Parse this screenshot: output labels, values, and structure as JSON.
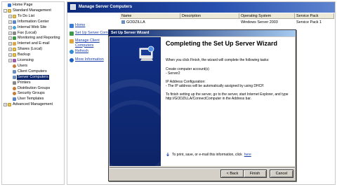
{
  "tree": {
    "items": [
      {
        "label": "Home Page",
        "icon": "home-icon",
        "indent": 0,
        "exp": ""
      },
      {
        "label": "Standard Management",
        "icon": "folder-icon",
        "indent": 0,
        "exp": "-"
      },
      {
        "label": "To Do List",
        "icon": "folder-icon",
        "indent": 1,
        "exp": "+"
      },
      {
        "label": "Information Center",
        "icon": "info-icon",
        "indent": 1,
        "exp": "+"
      },
      {
        "label": "Internal Web Site",
        "icon": "globe-icon",
        "indent": 1,
        "exp": "+"
      },
      {
        "label": "Fax (Local)",
        "icon": "fax-icon",
        "indent": 1,
        "exp": "+"
      },
      {
        "label": "Monitoring and Reporting",
        "icon": "monitor-icon",
        "indent": 1,
        "exp": "+"
      },
      {
        "label": "Internet and E-mail",
        "icon": "mail-icon",
        "indent": 1,
        "exp": "+"
      },
      {
        "label": "Shares (Local)",
        "icon": "folder-icon",
        "indent": 1,
        "exp": "+"
      },
      {
        "label": "Backup",
        "icon": "folder-icon",
        "indent": 1,
        "exp": "+"
      },
      {
        "label": "Licensing",
        "icon": "license-icon",
        "indent": 1,
        "exp": "+"
      },
      {
        "label": "Users",
        "icon": "user-icon",
        "indent": 1,
        "exp": ""
      },
      {
        "label": "Client Computers",
        "icon": "computer-icon",
        "indent": 1,
        "exp": ""
      },
      {
        "label": "Server Computers",
        "icon": "computer-icon",
        "indent": 1,
        "exp": "",
        "selected": true
      },
      {
        "label": "Printers",
        "icon": "printer-icon",
        "indent": 1,
        "exp": ""
      },
      {
        "label": "Distribution Groups",
        "icon": "group-icon",
        "indent": 1,
        "exp": ""
      },
      {
        "label": "Security Groups",
        "icon": "group-icon",
        "indent": 1,
        "exp": ""
      },
      {
        "label": "User Templates",
        "icon": "template-icon",
        "indent": 1,
        "exp": ""
      },
      {
        "label": "Advanced Management",
        "icon": "folder-icon",
        "indent": 0,
        "exp": "+"
      }
    ]
  },
  "banner": {
    "title": "Manage Server Computers"
  },
  "tasks": [
    {
      "label": "Home",
      "icon": "home-icon"
    },
    {
      "label": "Set Up Server Comp",
      "icon": "setup-icon"
    },
    {
      "label": "Manage Client Computers",
      "icon": "manage-icon"
    },
    {
      "label": "Refresh",
      "icon": "refresh-icon"
    },
    {
      "label": "More Information",
      "icon": "info-icon"
    }
  ],
  "table": {
    "headers": [
      "Name",
      "Description",
      "Operating System",
      "Service Pack"
    ],
    "rows": [
      {
        "name": "GODZILLA",
        "description": "",
        "os": "Windows Server 2003",
        "sp": "Service Pack 1"
      }
    ]
  },
  "wizard": {
    "title": "Set Up Server Wizard",
    "heading": "Completing the Set Up Server Wizard",
    "intro": "When you click Finish, the wizard will complete the following tasks:",
    "create_label": "Create computer account(s)",
    "create_item": "- Server2",
    "ip_label": "IP Address Configuration:",
    "ip_item": "- The IP address will be automatically assigned by using DHCP.",
    "finish_text": "To finish setting up the server, go to the server, start Internet Explorer, and type http://GODZILLA/ConnectComputer in the Address bar.",
    "print_text": "To print, save, or e-mail this information, click",
    "print_link": "here",
    "back_label": "< Back",
    "finish_label": "Finish",
    "cancel_label": "Cancel"
  }
}
